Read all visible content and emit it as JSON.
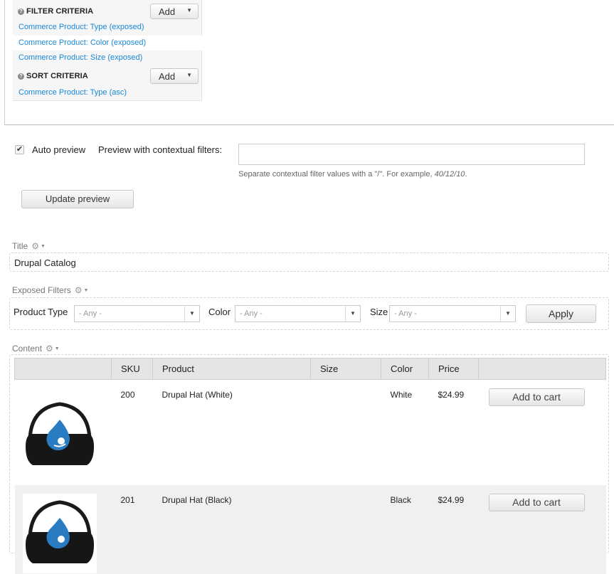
{
  "filter_criteria": {
    "title": "FILTER CRITERIA",
    "add_label": "Add",
    "items": [
      "Commerce Product: Type (exposed)",
      "Commerce Product: Color (exposed)",
      "Commerce Product: Size (exposed)"
    ]
  },
  "sort_criteria": {
    "title": "SORT CRITERIA",
    "add_label": "Add",
    "items": [
      "Commerce Product: Type (asc)"
    ]
  },
  "preview": {
    "auto_preview_label": "Auto preview",
    "auto_preview_checked": true,
    "contextual_label": "Preview with contextual filters:",
    "contextual_value": "",
    "description_prefix": "Separate contextual filter values with a \"/\". For example, ",
    "description_example": "40/12/10",
    "description_suffix": ".",
    "update_button": "Update preview"
  },
  "title_section": {
    "label": "Title",
    "value": "Drupal Catalog"
  },
  "exposed_filters": {
    "label": "Exposed Filters",
    "product_type_label": "Product Type",
    "product_type_value": "- Any -",
    "color_label": "Color",
    "color_value": "- Any -",
    "size_label": "Size",
    "size_value": "- Any -",
    "apply_button": "Apply"
  },
  "content": {
    "label": "Content",
    "columns": [
      "",
      "SKU",
      "Product",
      "Size",
      "Color",
      "Price",
      ""
    ],
    "rows": [
      {
        "sku": "200",
        "product": "Drupal Hat (White)",
        "size": "",
        "color": "White",
        "price": "$24.99",
        "button": "Add to cart",
        "hat_color": "#ffffff"
      },
      {
        "sku": "201",
        "product": "Drupal Hat (Black)",
        "size": "",
        "color": "Black",
        "price": "$24.99",
        "button": "Add to cart",
        "hat_color": "#111111"
      }
    ]
  },
  "colors": {
    "link": "#1a87d6",
    "drop": "#2a7cc2"
  }
}
